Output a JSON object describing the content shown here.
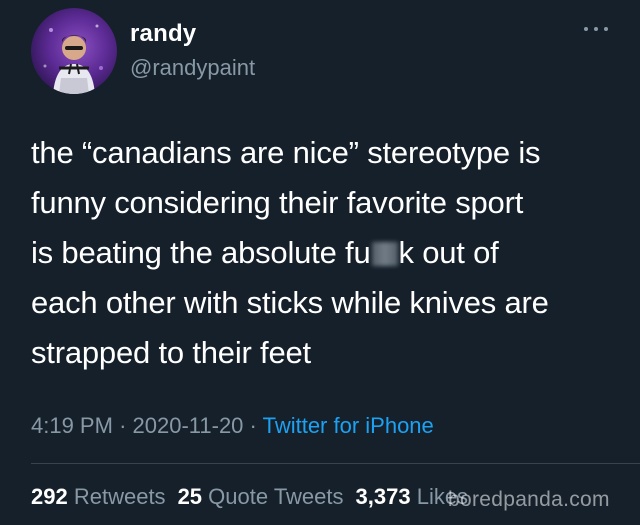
{
  "tweet": {
    "user": {
      "name": "randy",
      "handle": "@randypaint",
      "avatar_icon": "user-avatar-photo"
    },
    "more_icon": "more-horizontal-icon",
    "text": {
      "line1": "the “canadians are nice” stereotype is",
      "line2": "funny considering their favorite sport",
      "line3_before": "is beating the absolute fu",
      "line3_after": "k out of",
      "line4": "each other with sticks while knives are",
      "line5": "strapped to their feet"
    },
    "meta": {
      "time": "4:19 PM",
      "separator": "·",
      "date": "2020-11-20",
      "source": "Twitter for iPhone"
    },
    "stats": {
      "retweets_count": "292",
      "retweets_label": "Retweets",
      "quotes_count": "25",
      "quotes_label": "Quote Tweets",
      "likes_count": "3,373",
      "likes_label": "Likes"
    },
    "watermark": "boredpanda.com"
  },
  "colors": {
    "background": "#15202b",
    "primary_text": "#ffffff",
    "secondary_text": "#8899a6",
    "link": "#1da1f2",
    "divider": "#38444d"
  }
}
